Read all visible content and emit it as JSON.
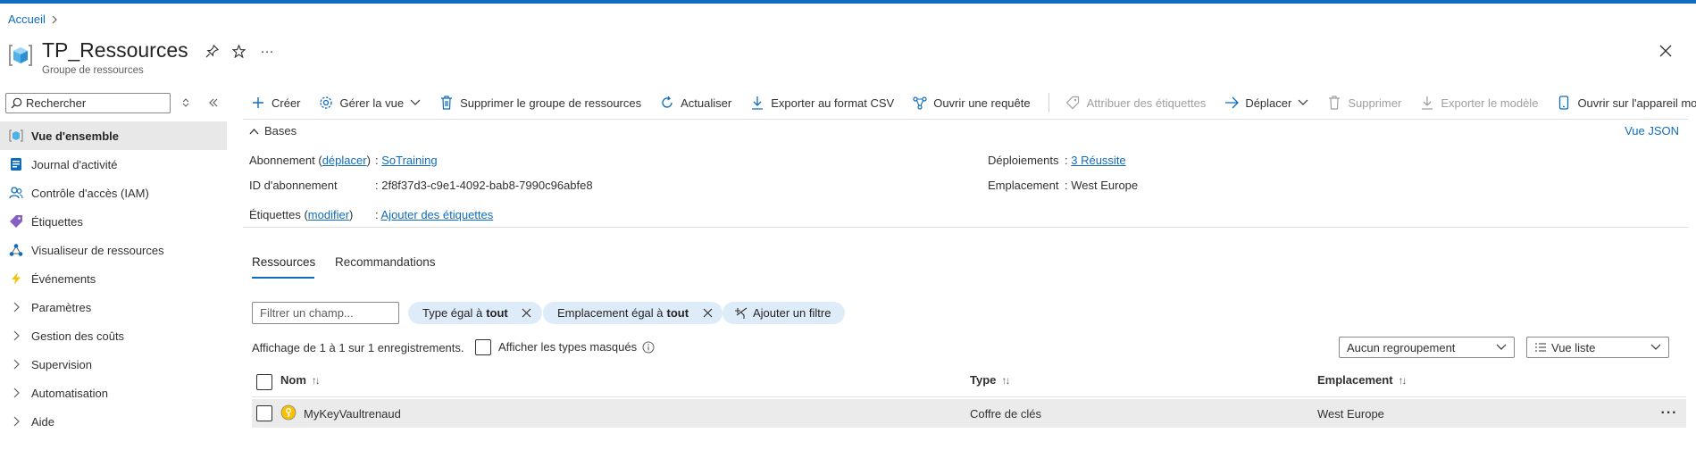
{
  "breadcrumb": {
    "home": "Accueil",
    "separator": ">"
  },
  "header": {
    "title": "TP_Ressources",
    "subtitle": "Groupe de ressources",
    "more": "···"
  },
  "sidebar": {
    "search_placeholder": "Rechercher",
    "items": [
      {
        "label": "Vue d'ensemble",
        "icon": "resource-group-icon",
        "active": true
      },
      {
        "label": "Journal d'activité",
        "icon": "activity-log-icon"
      },
      {
        "label": "Contrôle d'accès (IAM)",
        "icon": "people-icon"
      },
      {
        "label": "Étiquettes",
        "icon": "tag-icon"
      },
      {
        "label": "Visualiseur de ressources",
        "icon": "resource-visualizer-icon"
      },
      {
        "label": "Événements",
        "icon": "lightning-icon"
      },
      {
        "label": "Paramètres",
        "expandable": true
      },
      {
        "label": "Gestion des coûts",
        "expandable": true
      },
      {
        "label": "Supervision",
        "expandable": true
      },
      {
        "label": "Automatisation",
        "expandable": true
      },
      {
        "label": "Aide",
        "expandable": true
      }
    ]
  },
  "toolbar": {
    "create": "Créer",
    "manage_view": "Gérer la vue",
    "delete_group": "Supprimer le groupe de ressources",
    "refresh": "Actualiser",
    "export_csv": "Exporter au format CSV",
    "open_query": "Ouvrir une requête",
    "assign_tags": "Attribuer des étiquettes",
    "move": "Déplacer",
    "delete": "Supprimer",
    "export_template": "Exporter le modèle",
    "open_mobile": "Ouvrir sur l'appareil mobile"
  },
  "essentials": {
    "section_title": "Bases",
    "json_view": "Vue JSON",
    "subscription_label": "Abonnement",
    "subscription_move": "déplacer",
    "subscription_value": "SoTraining",
    "subscription_id_label": "ID d'abonnement",
    "subscription_id_value": "2f8f37d3-c9e1-4092-bab8-7990c96abfe8",
    "tags_label": "Étiquettes",
    "tags_modify": "modifier",
    "tags_value": "Ajouter des étiquettes",
    "deployments_label": "Déploiements",
    "deployments_value": "3 Réussite",
    "location_label": "Emplacement",
    "location_value": "West Europe"
  },
  "tabs": {
    "resources": "Ressources",
    "recommendations": "Recommandations"
  },
  "filters": {
    "field_placeholder": "Filtrer un champ...",
    "type_prefix": "Type égal à",
    "type_value": "tout",
    "location_prefix": "Emplacement égal à",
    "location_value": "tout",
    "add_filter": "Ajouter un filtre"
  },
  "list": {
    "count_text": "Affichage de 1 à 1 sur 1 enregistrements.",
    "show_hidden": "Afficher les types masqués",
    "grouping": "Aucun regroupement",
    "view_mode": "Vue liste",
    "columns": {
      "name": "Nom",
      "type": "Type",
      "location": "Emplacement"
    },
    "rows": [
      {
        "name": "MyKeyVaultrenaud",
        "type": "Coffre de clés",
        "location": "West Europe",
        "icon": "key-vault-icon"
      }
    ]
  }
}
